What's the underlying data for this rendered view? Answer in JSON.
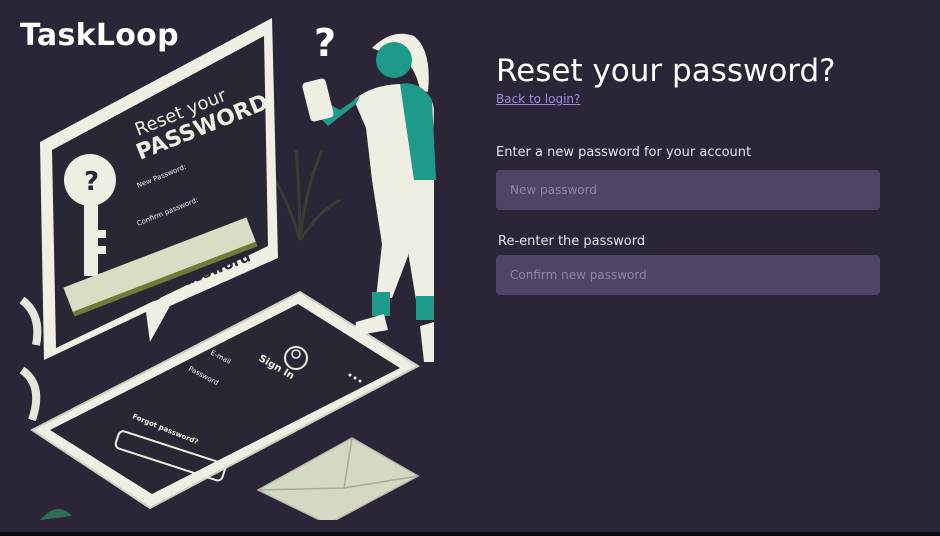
{
  "brand": {
    "name": "TaskLoop"
  },
  "illustration": {
    "card_heading_line1": "Reset your",
    "card_heading_line2": "PASSWORD",
    "card_field_new": "New Password:",
    "card_field_confirm": "Confirm password:",
    "card_button": "Change Password",
    "phone_email": "E-mail",
    "phone_password": "Password",
    "phone_signin": "Sign In",
    "phone_forgot": "Forgot password?",
    "question_mark": "?",
    "key_mark": "?"
  },
  "form": {
    "title": "Reset your password?",
    "back_link": "Back to login?",
    "new_password": {
      "label": "Enter a new password for your account",
      "placeholder": "New password",
      "value": ""
    },
    "confirm_password": {
      "label": "Re-enter the password",
      "placeholder": "Confirm new password",
      "value": ""
    }
  },
  "colors": {
    "background": "#2b2537",
    "input_bg": "#4f4464",
    "link": "#a287e0",
    "accent_teal": "#1d9a8a",
    "illustration_cream": "#efeee2"
  }
}
